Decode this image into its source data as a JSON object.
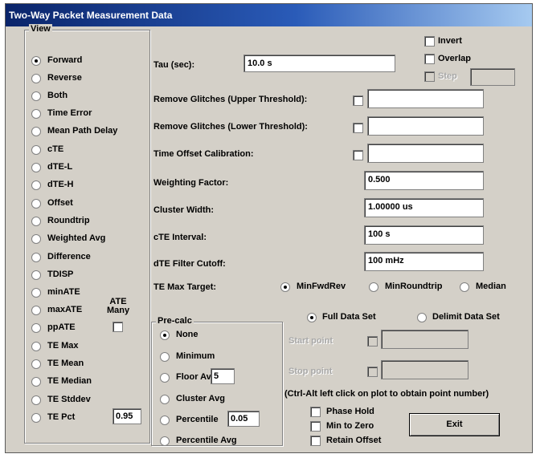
{
  "window": {
    "title": "Two-Way Packet Measurement Data"
  },
  "view": {
    "legend": "View",
    "options": [
      "Forward",
      "Reverse",
      "Both",
      "Time Error",
      "Mean Path Delay",
      "cTE",
      "dTE-L",
      "dTE-H",
      "Offset",
      "Roundtrip",
      "Weighted Avg",
      "Difference",
      "TDISP",
      "minATE",
      "maxATE",
      "ppATE",
      "TE Max",
      "TE Mean",
      "TE Median",
      "TE Stddev",
      "TE Pct"
    ],
    "selected": "Forward",
    "ate_many_label": "ATE Many",
    "te_pct_value": "0.95"
  },
  "precalc": {
    "legend": "Pre-calc",
    "options": [
      "None",
      "Minimum",
      "Floor Avg",
      "Cluster Avg",
      "Percentile",
      "Percentile Avg"
    ],
    "selected": "None",
    "floor_avg_value": "5",
    "percentile_value": "0.05"
  },
  "options_top": {
    "invert_label": "Invert",
    "overlap_label": "Overlap",
    "disabled_label": "Step"
  },
  "params": {
    "tau_label": "Tau (sec):",
    "tau_value": "10.0 s",
    "glitch_upper_label": "Remove Glitches (Upper Threshold):",
    "glitch_upper_value": "",
    "glitch_lower_label": "Remove Glitches (Lower Threshold):",
    "glitch_lower_value": "",
    "time_offset_label": "Time Offset Calibration:",
    "time_offset_value": "",
    "weighting_label": "Weighting Factor:",
    "weighting_value": "0.500",
    "cluster_label": "Cluster Width:",
    "cluster_value": "1.00000 us",
    "cte_interval_label": "cTE Interval:",
    "cte_interval_value": "100 s",
    "dte_cutoff_label": "dTE Filter Cutoff:",
    "dte_cutoff_value": "100 mHz"
  },
  "te_target": {
    "label": "TE Max Target:",
    "options": [
      "MinFwdRev",
      "MinRoundtrip",
      "Median"
    ],
    "selected": "MinFwdRev"
  },
  "dataset": {
    "options": [
      "Full Data Set",
      "Delimit Data Set"
    ],
    "selected": "Full Data Set",
    "start_label": "Start point",
    "stop_label": "Stop point",
    "hint": "(Ctrl-Alt left click on plot to obtain point number)"
  },
  "bottom": {
    "phase_hold_label": "Phase Hold",
    "min_to_zero_label": "Min to Zero",
    "retain_offset_label": "Retain Offset",
    "exit_label": "Exit"
  }
}
